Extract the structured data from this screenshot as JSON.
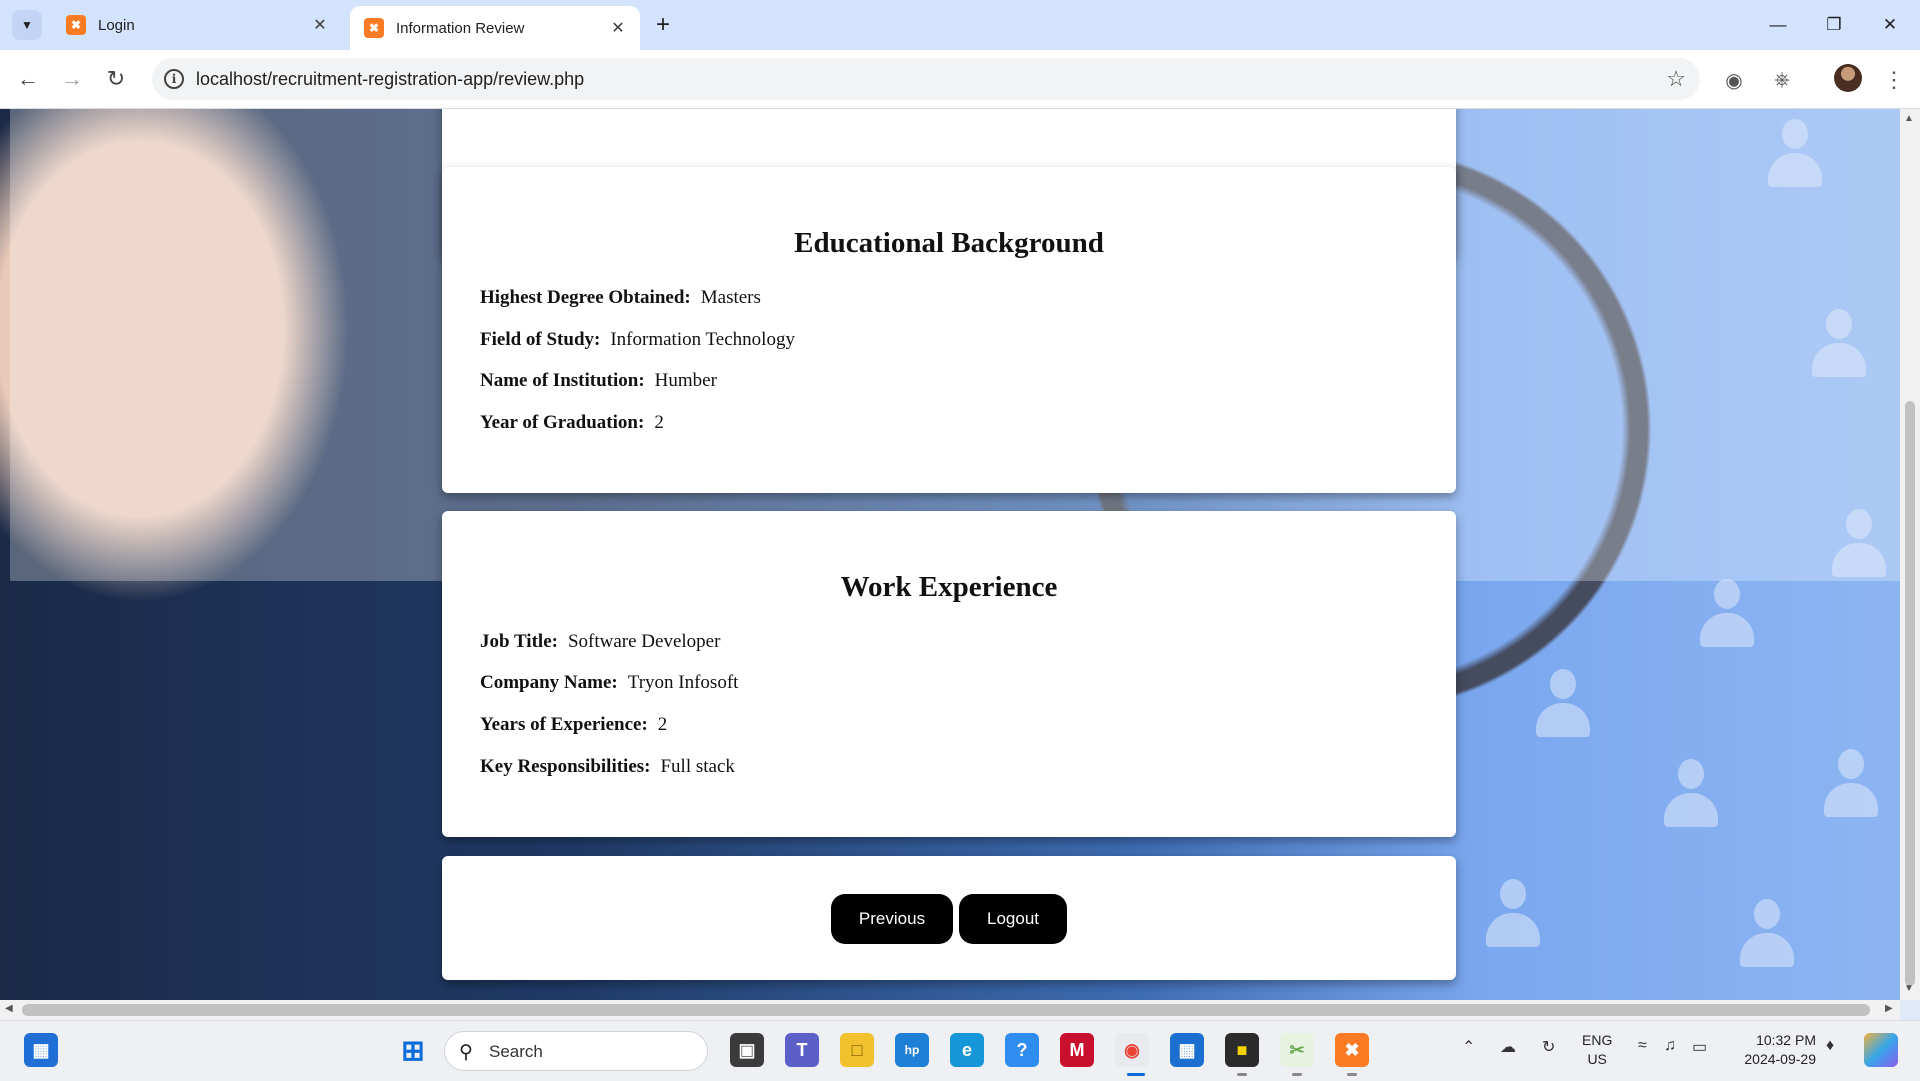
{
  "browser": {
    "tabs": [
      {
        "title": "Login",
        "favicon": "xampp-icon"
      },
      {
        "title": "Information Review",
        "favicon": "xampp-icon"
      }
    ],
    "new_tab": "+",
    "url": "localhost/recruitment-registration-app/review.php"
  },
  "education": {
    "heading": "Educational Background",
    "fields": [
      {
        "label": "Highest Degree Obtained:",
        "value": "Masters"
      },
      {
        "label": "Field of Study:",
        "value": "Information Technology"
      },
      {
        "label": "Name of Institution:",
        "value": "Humber"
      },
      {
        "label": "Year of Graduation:",
        "value": "2"
      }
    ]
  },
  "work": {
    "heading": "Work Experience",
    "fields": [
      {
        "label": "Job Title:",
        "value": "Software Developer"
      },
      {
        "label": "Company Name:",
        "value": "Tryon Infosoft"
      },
      {
        "label": "Years of Experience:",
        "value": "2"
      },
      {
        "label": "Key Responsibilities:",
        "value": "Full stack"
      }
    ]
  },
  "actions": {
    "previous": "Previous",
    "logout": "Logout"
  },
  "taskbar": {
    "search_placeholder": "Search",
    "lang_line1": "ENG",
    "lang_line2": "US",
    "time": "10:32 PM",
    "date": "2024-09-29"
  },
  "colors": {
    "tab_strip": "#d3e3fd",
    "button": "#000000",
    "xampp": "#fb7a24"
  }
}
